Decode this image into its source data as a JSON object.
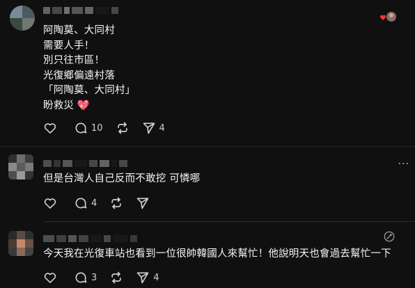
{
  "posts": [
    {
      "text": "阿陶莫、大同村\n需要人手！\n別只往市區！\n光復鄉偏遠村落\n「阿陶莫、大同村」\n盼救災 💖",
      "replies": "10",
      "shares": "4"
    },
    {
      "text": "但是台灣人自己反而不敢挖 可憐哪",
      "more": "···",
      "replies": "4",
      "shares": ""
    },
    {
      "text": "今天我在光復車站也看到一位很帥韓國人來幫忙！他說明天也會過去幫忙一下",
      "replies": "3",
      "shares": "4"
    }
  ],
  "icons": {
    "like": "heart-outline-icon",
    "reply": "speech-bubble-icon",
    "repost": "repost-arrows-icon",
    "share": "paper-plane-icon",
    "heart_badge": "heart-red-icon",
    "edit": "edit-pen-icon"
  },
  "colors": {
    "background": "#101010",
    "text": "#f3f5f7",
    "icon": "#d0d0d0",
    "divider": "#2c2c2c",
    "heart": "#ff3040"
  }
}
